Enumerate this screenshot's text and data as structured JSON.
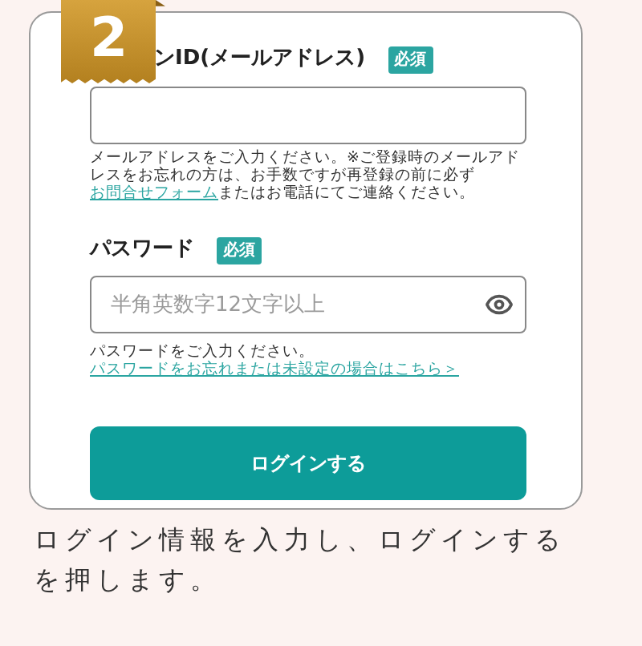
{
  "badge": {
    "number": "2"
  },
  "email": {
    "label": "ンID(メールアドレス)",
    "required": "必須",
    "help": "メールアドレスをご入力ください。※ご登録時のメールアドレスをお忘れの方は、お手数ですが再登録の前に必ず",
    "help_link": "お問合せフォーム",
    "help_after": "またはお電話にてご連絡ください。"
  },
  "password": {
    "label": "パスワード",
    "required": "必須",
    "placeholder": "半角英数字12文字以上",
    "help": "パスワードをご入力ください。",
    "help_link": "パスワードをお忘れまたは未設定の場合はこちら＞"
  },
  "login_button": "ログインする",
  "caption": "ログイン情報を入力し、ログインするを押します。"
}
